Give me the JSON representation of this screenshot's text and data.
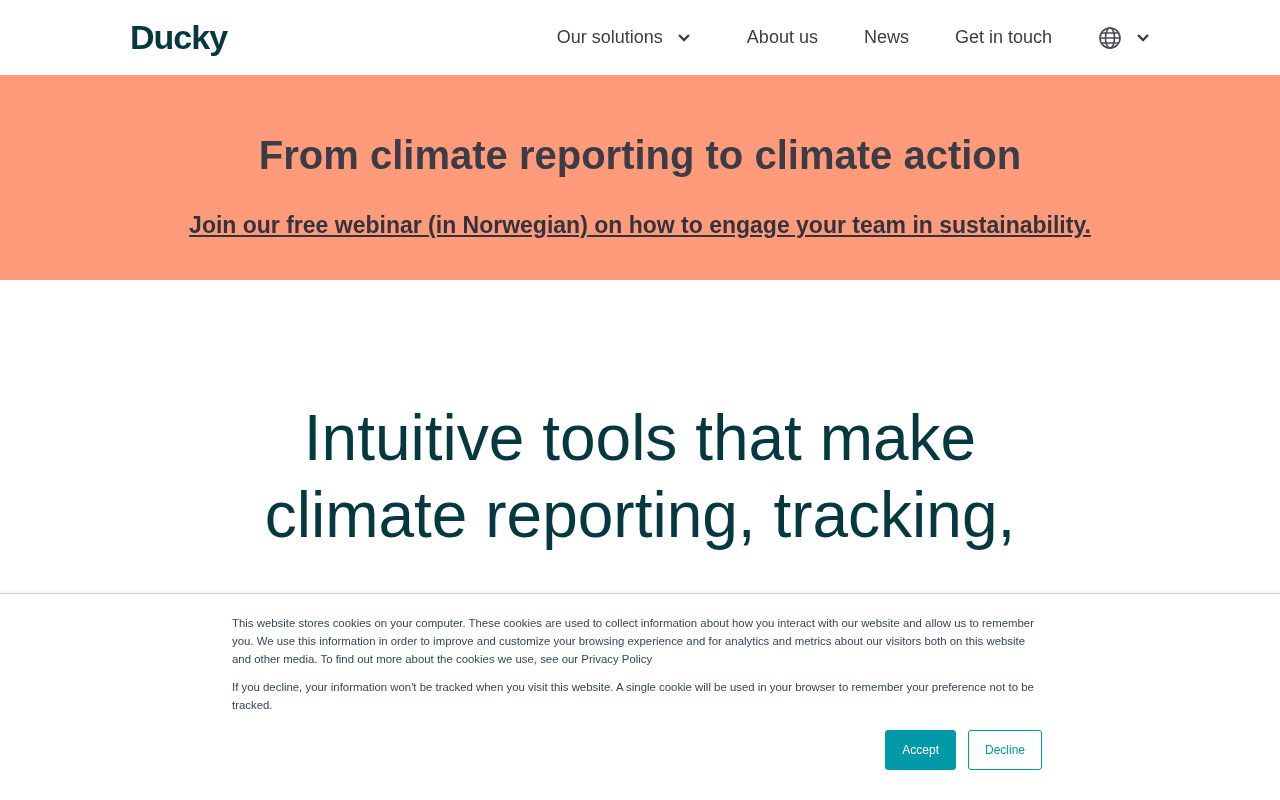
{
  "header": {
    "logo": "Ducky",
    "nav": [
      {
        "label": "Our solutions",
        "has_dropdown": true
      },
      {
        "label": "About us",
        "has_dropdown": false
      },
      {
        "label": "News",
        "has_dropdown": false
      },
      {
        "label": "Get in touch",
        "has_dropdown": false
      }
    ]
  },
  "promo": {
    "title": "From climate reporting to climate action",
    "link": "Join our free webinar (in Norwegian) on how to engage your team in sustainability."
  },
  "hero": {
    "heading": "Intuitive tools that make climate reporting, tracking,"
  },
  "cookie_banner": {
    "paragraphs": [
      "This website stores cookies on your computer. These cookies are used to collect information about how you interact with our website and allow us to remember you. We use this information in order to improve and customize your browsing experience and for analytics and metrics about our visitors both on this website and other media. To find out more about the cookies we use, see our Privacy Policy",
      "If you decline, your information won't be tracked when you visit this website. A single cookie will be used in your browser to remember your preference not to be tracked."
    ],
    "buttons": [
      {
        "label": "Accept",
        "kind": "primary"
      },
      {
        "label": "Decline",
        "kind": "outline"
      }
    ]
  }
}
